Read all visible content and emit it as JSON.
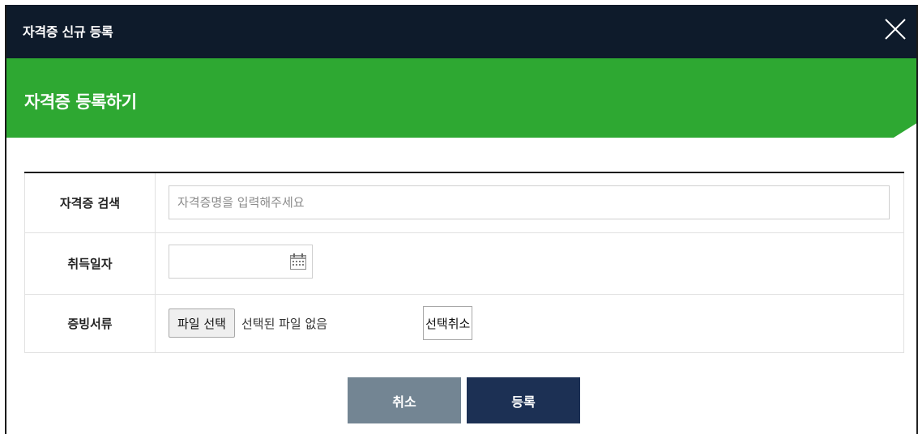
{
  "dialog": {
    "title": "자격증 신규 등록",
    "close_icon": "close-icon"
  },
  "banner": {
    "heading": "자격증 등록하기"
  },
  "form": {
    "search_label": "자격증 검색",
    "search_placeholder": "자격증명을 입력해주세요",
    "date_label": "취득일자",
    "date_value": "",
    "calendar_icon": "calendar-icon",
    "document_label": "증빙서류",
    "file_button": "파일 선택",
    "file_status": "선택된 파일 없음",
    "cancel_select_button": "선택취소"
  },
  "buttons": {
    "cancel": "취소",
    "register": "등록"
  },
  "colors": {
    "titlebar": "#0e1b2b",
    "banner": "#2ea832",
    "cancel_button": "#738593",
    "register_button": "#1c3054"
  }
}
